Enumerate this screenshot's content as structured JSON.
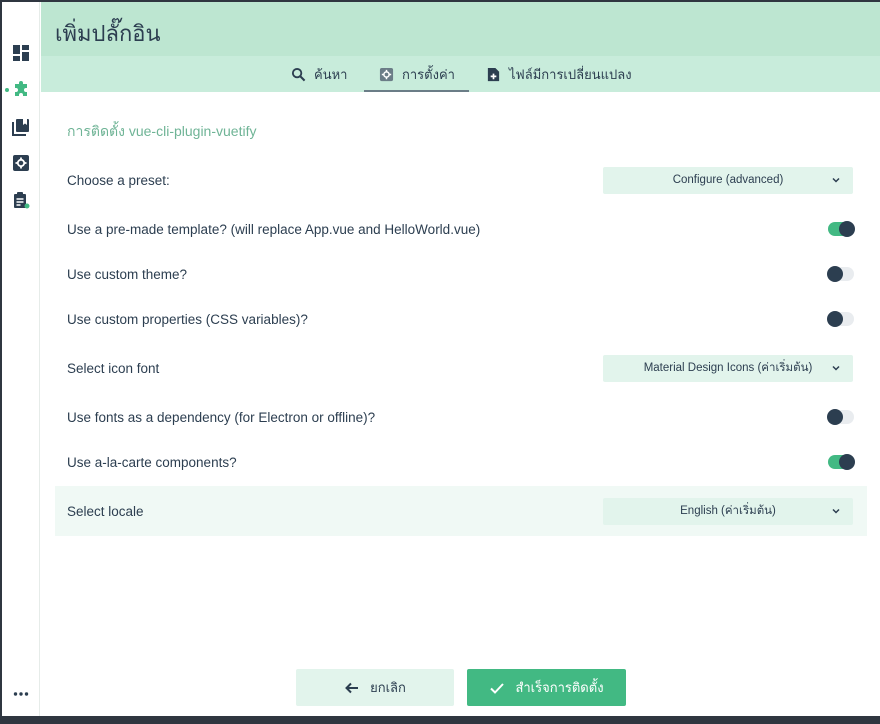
{
  "header": {
    "title": "เพิ่มปลั๊กอิน",
    "tabs": [
      {
        "label": "ค้นหา",
        "icon": "search-icon"
      },
      {
        "label": "การตั้งค่า",
        "icon": "settings-icon",
        "selected": true
      },
      {
        "label": "ไฟล์มีการเปลี่ยนแปลง",
        "icon": "file-changes-icon"
      }
    ]
  },
  "sidebar": {
    "items": [
      {
        "icon": "dashboard-icon"
      },
      {
        "icon": "plugins-icon",
        "active": true
      },
      {
        "icon": "dependencies-icon"
      },
      {
        "icon": "configuration-icon"
      },
      {
        "icon": "tasks-icon"
      }
    ],
    "more_icon": "more-icon"
  },
  "section": {
    "title": "การติดตั้ง vue-cli-plugin-vuetify"
  },
  "settings": [
    {
      "label": "Choose a preset:",
      "type": "select",
      "value": "Configure (advanced)"
    },
    {
      "label": "Use a pre-made template? (will replace App.vue and HelloWorld.vue)",
      "type": "toggle",
      "on": true
    },
    {
      "label": "Use custom theme?",
      "type": "toggle",
      "on": false
    },
    {
      "label": "Use custom properties (CSS variables)?",
      "type": "toggle",
      "on": false
    },
    {
      "label": "Select icon font",
      "type": "select",
      "value": "Material Design Icons (ค่าเริ่มต้น)"
    },
    {
      "label": "Use fonts as a dependency (for Electron or offline)?",
      "type": "toggle",
      "on": false
    },
    {
      "label": "Use a-la-carte components?",
      "type": "toggle",
      "on": true
    },
    {
      "label": "Select locale",
      "type": "select",
      "value": "English (ค่าเริ่มต้น)"
    }
  ],
  "footer": {
    "cancel_label": "ยกเลิก",
    "finish_label": "สำเร็จการติดตั้ง"
  },
  "colors": {
    "accent": "#42b983",
    "header_bg": "#bde6d1",
    "tabs_bg": "#c8ecdb",
    "dark": "#2c3e50"
  }
}
